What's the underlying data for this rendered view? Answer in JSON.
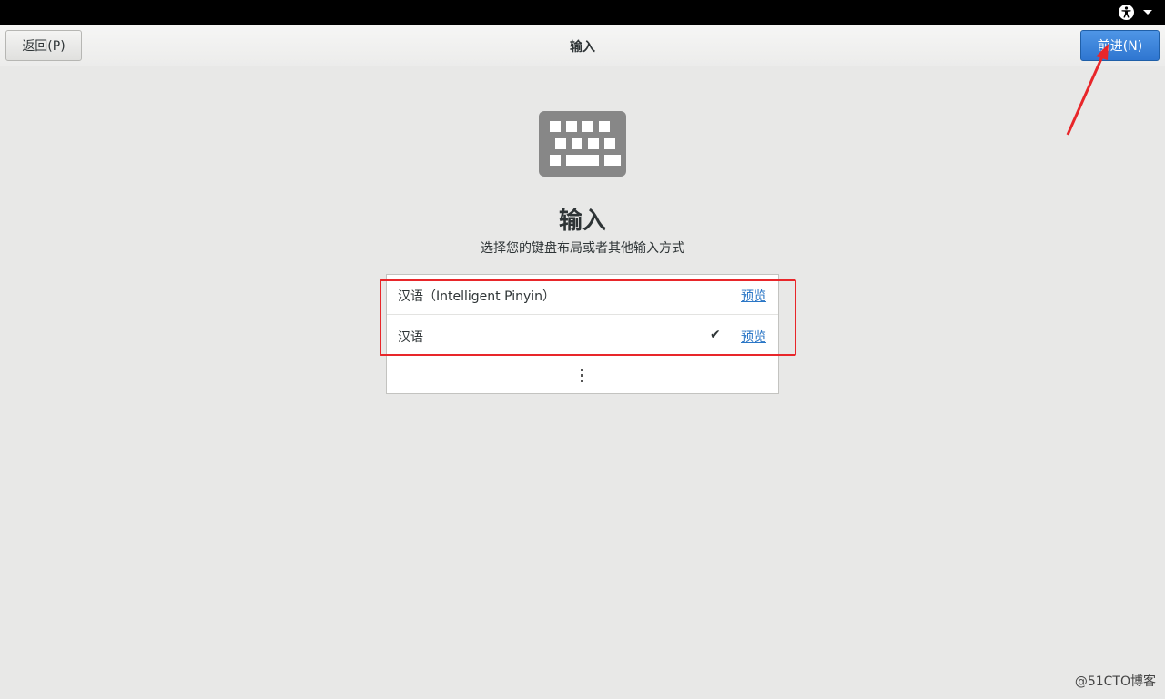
{
  "topbar": {
    "accessibility_icon": "accessibility-icon",
    "menu_icon": "chevron-down-icon"
  },
  "header": {
    "back_label": "返回(P)",
    "title": "输入",
    "next_label": "前进(N)"
  },
  "main": {
    "icon": "keyboard-icon",
    "title": "输入",
    "subtitle": "选择您的键盘布局或者其他输入方式",
    "items": [
      {
        "label": "汉语（Intelligent Pinyin）",
        "preview": "预览",
        "selected": false
      },
      {
        "label": "汉语",
        "preview": "预览",
        "selected": true,
        "check": "✔"
      }
    ],
    "more_icon": "more-vertical-icon"
  },
  "watermark": "@51CTO博客",
  "colors": {
    "accent": "#2f76d0",
    "annotation": "#e8262a"
  }
}
